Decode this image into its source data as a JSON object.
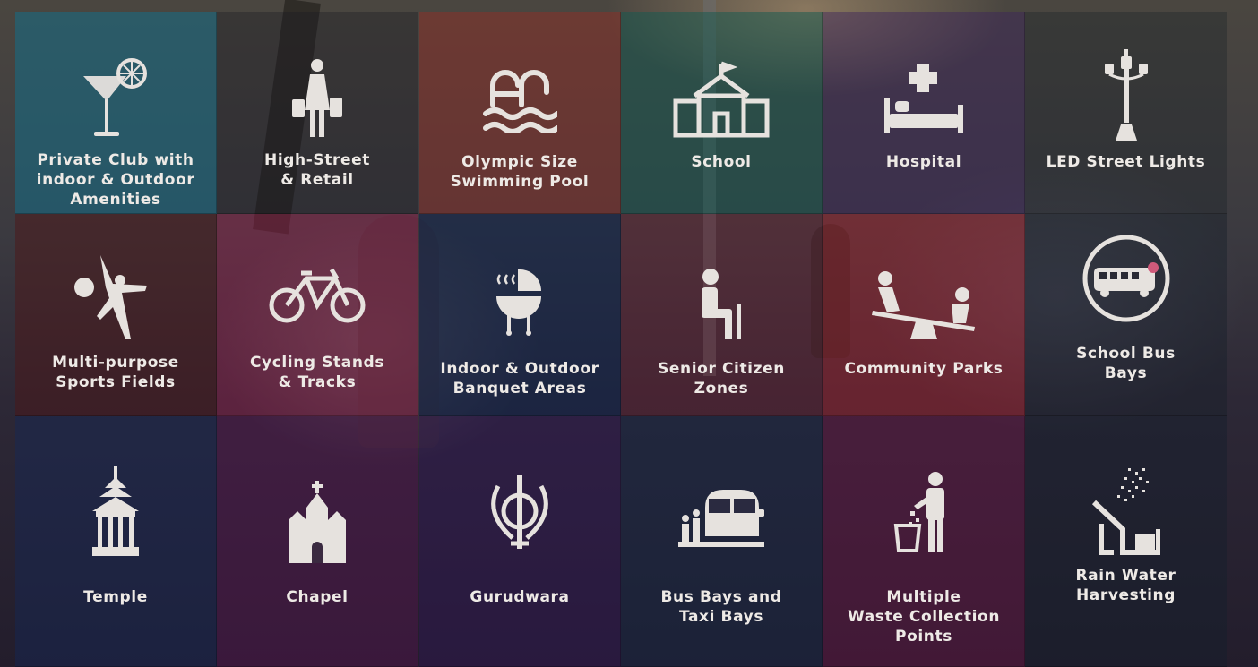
{
  "amenities": [
    {
      "label": "Private Club with\nindoor & Outdoor\nAmenities",
      "icon": "cocktail-icon"
    },
    {
      "label": "High-Street\n& Retail",
      "icon": "shopper-icon"
    },
    {
      "label": "Olympic Size\nSwimming Pool",
      "icon": "pool-icon"
    },
    {
      "label": "School",
      "icon": "school-building-icon"
    },
    {
      "label": "Hospital",
      "icon": "hospital-bed-icon"
    },
    {
      "label": "LED Street Lights",
      "icon": "street-lamp-icon"
    },
    {
      "label": "Multi-purpose\nSports Fields",
      "icon": "sports-player-icon"
    },
    {
      "label": "Cycling Stands\n& Tracks",
      "icon": "bicycle-icon"
    },
    {
      "label": "Indoor & Outdoor\nBanquet Areas",
      "icon": "barbecue-grill-icon"
    },
    {
      "label": "Senior Citizen\nZones",
      "icon": "senior-citizen-icon"
    },
    {
      "label": "Community Parks",
      "icon": "seesaw-icon"
    },
    {
      "label": "School Bus\nBays",
      "icon": "school-bus-icon"
    },
    {
      "label": "Temple",
      "icon": "temple-icon"
    },
    {
      "label": "Chapel",
      "icon": "chapel-icon"
    },
    {
      "label": "Gurudwara",
      "icon": "khanda-icon"
    },
    {
      "label": "Bus Bays and\nTaxi Bays",
      "icon": "bus-stop-icon"
    },
    {
      "label": "Multiple\nWaste Collection\nPoints",
      "icon": "waste-bin-icon"
    },
    {
      "label": "Rain Water\nHarvesting",
      "icon": "rain-harvesting-icon"
    }
  ],
  "colors": {
    "text": "#eeeae6",
    "icon": "#e6e2de"
  }
}
